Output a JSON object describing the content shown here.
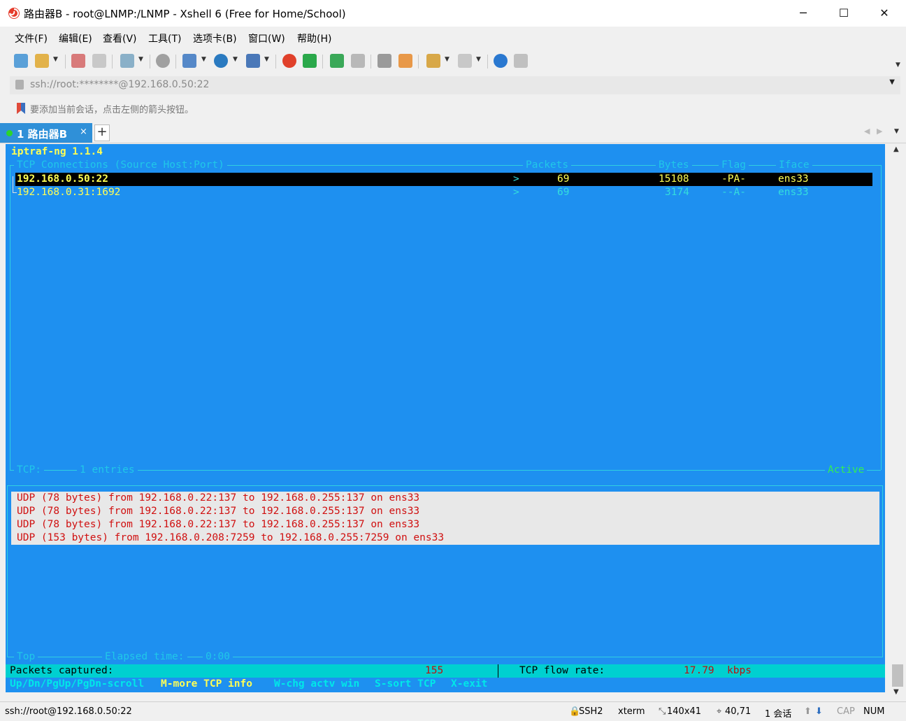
{
  "window": {
    "title": "路由器B - root@LNMP:/LNMP - Xshell 6 (Free for Home/School)",
    "controls": {
      "minimize": "─",
      "maximize": "☐",
      "close": "✕"
    }
  },
  "menu": {
    "items": [
      "文件(F)",
      "编辑(E)",
      "查看(V)",
      "工具(T)",
      "选项卡(B)",
      "窗口(W)",
      "帮助(H)"
    ]
  },
  "toolbar": {
    "icons": [
      "new-session-icon",
      "open-folder-icon",
      "reconnect-icon",
      "disconnect-icon",
      "properties-icon",
      "find-icon",
      "layout-icon",
      "globe-icon",
      "font-icon",
      "xshell-icon",
      "xftp-icon",
      "fullscreen-icon",
      "lock-icon",
      "keyboard-icon",
      "highlight-icon",
      "new-tab-icon",
      "compose-icon",
      "help-icon",
      "chat-icon"
    ]
  },
  "address": {
    "value": "ssh://root:********@192.168.0.50:22"
  },
  "hint": {
    "text": "要添加当前会话，点击左侧的箭头按钮。"
  },
  "tabs": [
    {
      "label": "1 路由器B",
      "close": "×"
    }
  ],
  "tab_add": "+",
  "terminal": {
    "header": "iptraf-ng 1.1.4",
    "tcp_box_title": "TCP Connections (Source Host:Port)",
    "columns": {
      "packets": "Packets",
      "bytes": "Bytes",
      "flag": "Flag",
      "iface": "Iface"
    },
    "rows": [
      {
        "host": "192.168.0.50:22",
        "dir": ">",
        "packets": "69",
        "bytes": "15108",
        "flag": "-PA-",
        "iface": "ens33"
      },
      {
        "host": "192.168.0.31:1692",
        "dir": ">",
        "packets": "69",
        "bytes": "3174",
        "flag": "--A-",
        "iface": "ens33"
      }
    ],
    "tcp_footer_label": "TCP:",
    "tcp_footer_entries": "1 entries",
    "tcp_footer_state": "Active",
    "udp_lines": [
      "UDP (78 bytes) from 192.168.0.22:137 to 192.168.0.255:137 on ens33",
      "UDP (78 bytes) from 192.168.0.22:137 to 192.168.0.255:137 on ens33",
      "UDP (78 bytes) from 192.168.0.22:137 to 192.168.0.255:137 on ens33",
      "UDP (153 bytes) from 192.168.0.208:7259 to 192.168.0.255:7259 on ens33"
    ],
    "bottom_label_top": "Top",
    "elapsed_label": "Elapsed time:",
    "elapsed_value": "0:00",
    "packets_captured_label": "Packets captured:",
    "packets_captured_value": "155",
    "flow_rate_label": "TCP flow rate:",
    "flow_rate_value": "17.79",
    "flow_rate_unit": "kbps",
    "keys": [
      "Up/Dn/PgUp/PgDn-scroll",
      "M-more TCP info",
      "W-chg actv win",
      "S-sort TCP",
      "X-exit"
    ]
  },
  "statusbar": {
    "connection": "ssh://root@192.168.0.50:22",
    "protocol": "SSH2",
    "term": "xterm",
    "size": "140x41",
    "cursor": "40,71",
    "sessions": "1 会话",
    "cap": "CAP",
    "num": "NUM"
  },
  "colors": {
    "terminal_bg": "#1e90f0",
    "tab_active": "#2f90d8",
    "highlight_text": "#ffff55",
    "udp_text": "#d01010"
  }
}
